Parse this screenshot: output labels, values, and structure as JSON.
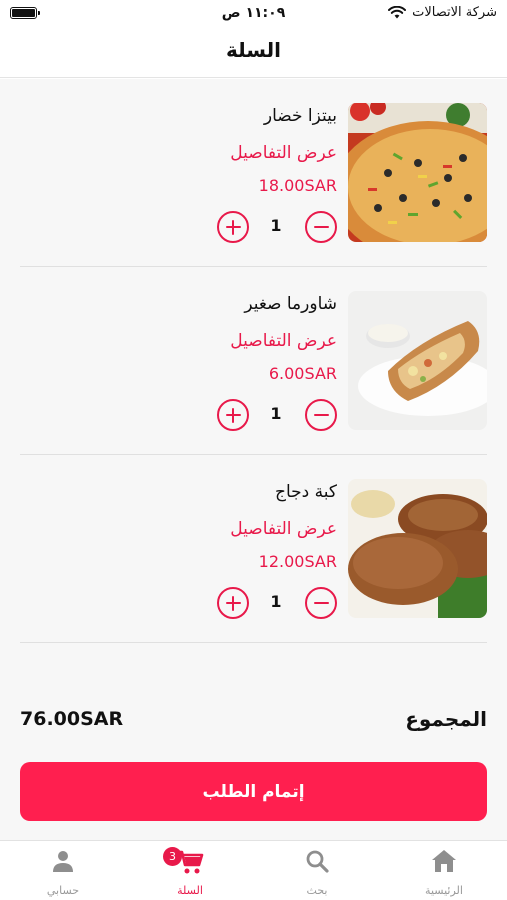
{
  "status_bar": {
    "carrier": "شركة الاتصالات",
    "time": "١١:٠٩ ص"
  },
  "header": {
    "title": "السلة"
  },
  "cart": {
    "items": [
      {
        "name": "بيتزا خضار",
        "details_link": "عرض التفاصيل",
        "price": "18.00SAR",
        "quantity": "1",
        "image_icon": "veggie-pizza-photo"
      },
      {
        "name": "شاورما صغير",
        "details_link": "عرض التفاصيل",
        "price": "6.00SAR",
        "quantity": "1",
        "image_icon": "shawarma-wrap-photo"
      },
      {
        "name": "كبة دجاج",
        "details_link": "عرض التفاصيل",
        "price": "12.00SAR",
        "quantity": "1",
        "image_icon": "chicken-kibbeh-photo"
      }
    ],
    "total_label": "المجموع",
    "total_value": "76.00SAR",
    "checkout_label": "إتمام الطلب"
  },
  "tab_bar": {
    "tabs": [
      {
        "label": "حسابي",
        "icon": "person-icon",
        "active": false
      },
      {
        "label": "السلة",
        "icon": "cart-icon",
        "active": true,
        "badge": "3"
      },
      {
        "label": "بحث",
        "icon": "search-icon",
        "active": false
      },
      {
        "label": "الرئيسية",
        "icon": "home-icon",
        "active": false
      }
    ]
  },
  "colors": {
    "accent": "#e8194a",
    "button": "#ff1f4f",
    "background": "#f7f7f7"
  }
}
